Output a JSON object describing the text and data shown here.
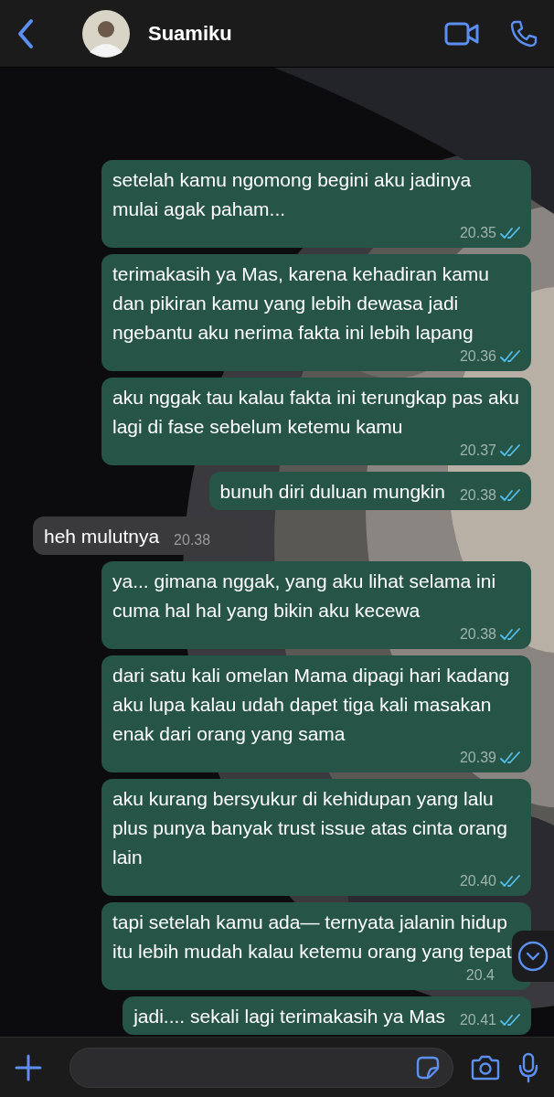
{
  "header": {
    "contact_name": "Suamiku"
  },
  "messages": [
    {
      "kind": "outgoing",
      "text": "setelah kamu ngomong begini aku jadinya mulai agak paham...",
      "time": "20.35",
      "read": true
    },
    {
      "kind": "outgoing",
      "text": "terimakasih ya Mas, karena kehadiran kamu dan pikiran kamu yang lebih dewasa jadi ngebantu aku nerima fakta ini lebih lapang",
      "time": "20.36",
      "read": true
    },
    {
      "kind": "outgoing",
      "text": "aku nggak tau kalau fakta ini terungkap pas aku lagi di fase sebelum ketemu kamu",
      "time": "20.37",
      "read": true
    },
    {
      "kind": "outgoing",
      "text": "bunuh diri duluan mungkin",
      "time": "20.38",
      "read": true
    },
    {
      "kind": "incoming",
      "text": "heh mulutnya",
      "time": "20.38"
    },
    {
      "kind": "outgoing",
      "text": "ya... gimana nggak, yang aku lihat selama ini cuma hal hal yang bikin aku kecewa",
      "time": "20.38",
      "read": true
    },
    {
      "kind": "outgoing",
      "text": "dari satu kali omelan Mama dipagi hari kadang aku lupa kalau udah dapet tiga kali masakan enak dari orang yang sama",
      "time": "20.39",
      "read": true
    },
    {
      "kind": "outgoing",
      "text": "aku kurang bersyukur di kehidupan yang lalu plus punya banyak trust issue atas cinta orang lain",
      "time": "20.40",
      "read": true
    },
    {
      "kind": "outgoing",
      "text": "tapi setelah kamu ada— ternyata jalanin hidup itu lebih mudah kalau ketemu orang yang tepat",
      "time": "20.4"
    },
    {
      "kind": "outgoing",
      "text": "jadi.... sekali lagi terimakasih ya Mas",
      "time": "20.41",
      "read": true
    }
  ]
}
